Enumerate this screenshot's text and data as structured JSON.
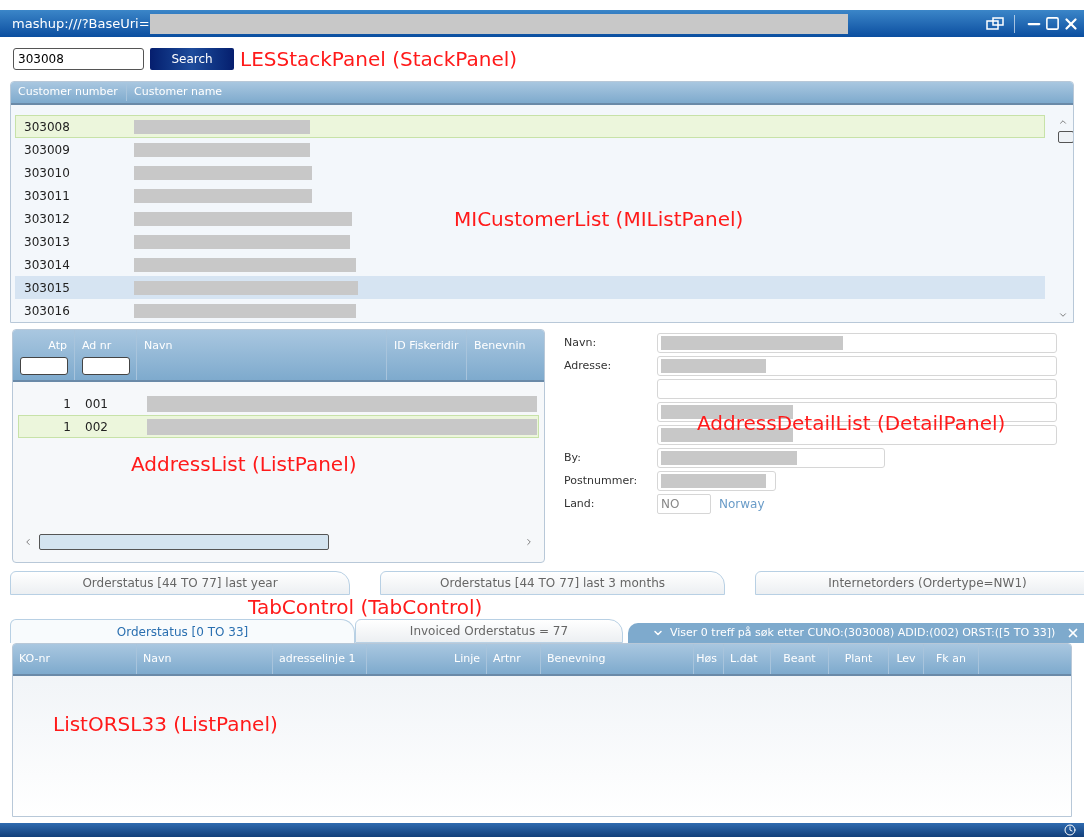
{
  "window": {
    "title": "mashup:///?BaseUri="
  },
  "search": {
    "value": "303008",
    "button": "Search",
    "annotation": "LESStackPanel (StackPanel)"
  },
  "customer_list": {
    "columns": [
      "Customer number",
      "Customer name"
    ],
    "annotation": "MICustomerList (MIListPanel)",
    "rows": [
      {
        "number": "303008",
        "selected": true,
        "hovered": false
      },
      {
        "number": "303009",
        "selected": false,
        "hovered": false
      },
      {
        "number": "303010",
        "selected": false,
        "hovered": false
      },
      {
        "number": "303011",
        "selected": false,
        "hovered": false
      },
      {
        "number": "303012",
        "selected": false,
        "hovered": false
      },
      {
        "number": "303013",
        "selected": false,
        "hovered": false
      },
      {
        "number": "303014",
        "selected": false,
        "hovered": false
      },
      {
        "number": "303015",
        "selected": false,
        "hovered": true
      },
      {
        "number": "303016",
        "selected": false,
        "hovered": false
      }
    ]
  },
  "address_list": {
    "columns": [
      "Atp",
      "Ad nr",
      "Navn",
      "ID Fiskeridir",
      "Benevnin"
    ],
    "annotation": "AddressList (ListPanel)",
    "rows": [
      {
        "atp": "1",
        "ad_nr": "001",
        "selected": false
      },
      {
        "atp": "1",
        "ad_nr": "002",
        "selected": true
      }
    ]
  },
  "address_detail": {
    "annotation": "AddressDetailList (DetailPanel)",
    "fields": [
      {
        "kind": "name",
        "label": "Navn:"
      },
      {
        "kind": "address",
        "label": "Adresse:"
      },
      {
        "kind": "city",
        "label": "By:"
      },
      {
        "kind": "postal",
        "label": "Postnummer:"
      },
      {
        "kind": "country",
        "label": "Land:",
        "value": "NO",
        "link": "Norway"
      }
    ]
  },
  "tabs": {
    "annotation": "TabControl (TabControl)",
    "rows": [
      [
        {
          "label": "Orderstatus [44 TO 77] last year",
          "selected": false
        },
        {
          "label": "Orderstatus [44 TO 77] last 3 months",
          "selected": false
        },
        {
          "label": "Internetorders (Ordertype=NW1)",
          "selected": false
        }
      ],
      [
        {
          "label": "Orderstatus [0 TO 33]",
          "selected": true
        },
        {
          "label": "Invoiced Orderstatus = 77",
          "selected": false
        }
      ]
    ]
  },
  "filter_bar": {
    "text": "Viser 0 treff på søk etter CUNO:(303008) ADID:(002) ORST:([5 TO 33])"
  },
  "order_list": {
    "annotation": "ListORSL33 (ListPanel)",
    "columns": [
      "KO-nr",
      "Navn",
      "adresselinje 1",
      "Linje",
      "Artnr",
      "Benevning",
      "Høs",
      "L.dat",
      "Beant",
      "Plant",
      "Lev",
      "Fk an"
    ]
  }
}
